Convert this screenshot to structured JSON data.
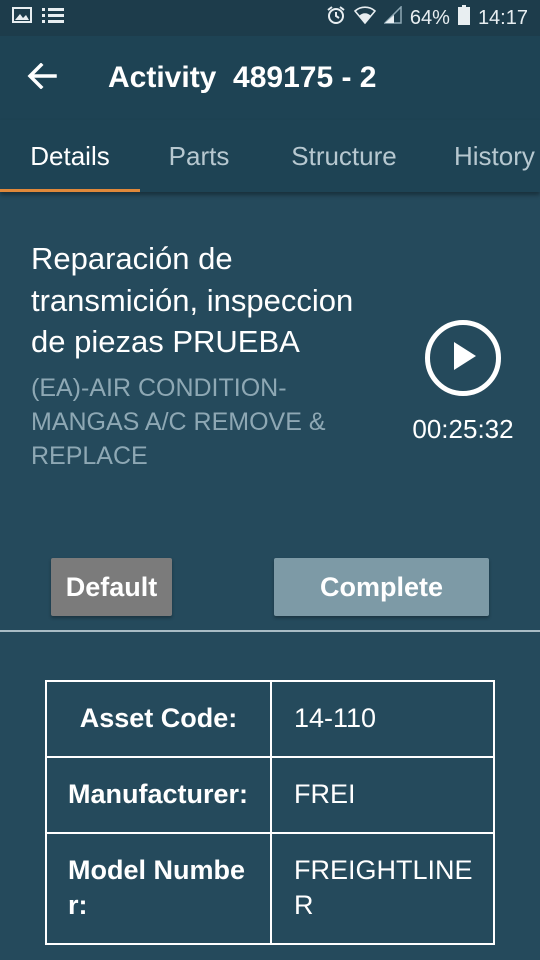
{
  "status_bar": {
    "icons_left": [
      "image-icon",
      "list-icon"
    ],
    "battery_percent": "64%",
    "time": "14:17"
  },
  "app_bar": {
    "title": "Activity  489175 - 2"
  },
  "tabs": [
    {
      "label": "Details",
      "active": true
    },
    {
      "label": "Parts",
      "active": false
    },
    {
      "label": "Structure",
      "active": false
    },
    {
      "label": "History",
      "active": false
    }
  ],
  "activity": {
    "title": "Reparación de transmición, inspeccion de piezas PRUEBA",
    "code": "(EA)-AIR CONDITION-MANGAS A/C REMOVE & REPLACE"
  },
  "timer": {
    "elapsed": "00:25:32"
  },
  "buttons": {
    "default_label": "Default",
    "complete_label": "Complete"
  },
  "details_table": [
    {
      "key": "Asset Code:",
      "value": "14-110"
    },
    {
      "key": "Manufacturer:",
      "value": "FREI"
    },
    {
      "key": "Model Number:",
      "value": "FREIGHTLINER"
    }
  ],
  "colors": {
    "background": "#254a5c",
    "app_bar": "#1e4354",
    "tab_indicator": "#e0883a",
    "default_button": "#7b7b7b",
    "complete_button": "#7d9aa6"
  }
}
